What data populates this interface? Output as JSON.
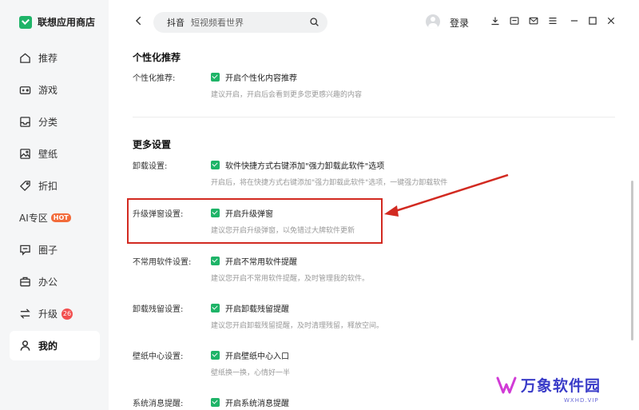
{
  "app": {
    "title": "联想应用商店"
  },
  "sidebar": {
    "items": [
      {
        "label": "推荐",
        "icon": "home-icon"
      },
      {
        "label": "游戏",
        "icon": "gamepad-icon"
      },
      {
        "label": "分类",
        "icon": "inbox-icon"
      },
      {
        "label": "壁纸",
        "icon": "image-icon"
      },
      {
        "label": "折扣",
        "icon": "tag-icon"
      },
      {
        "label": "AI专区",
        "icon": "ai-icon",
        "badge": "HOT"
      },
      {
        "label": "圈子",
        "icon": "chat-icon"
      },
      {
        "label": "办公",
        "icon": "briefcase-icon"
      },
      {
        "label": "升级",
        "icon": "swap-icon",
        "badge": "26"
      },
      {
        "label": "我的",
        "icon": "user-icon",
        "active": true
      }
    ]
  },
  "topbar": {
    "search_keyword": "抖音",
    "search_placeholder": "短视频看世界",
    "login_label": "登录"
  },
  "settings": {
    "personal": {
      "title": "个性化推荐",
      "label": "个性化推荐:",
      "option": "开启个性化内容推荐",
      "hint": "建议开启，开启后会看到更多您更感兴趣的内容"
    },
    "more_title": "更多设置",
    "uninstall": {
      "label": "卸载设置:",
      "option": "软件快捷方式右键添加\"强力卸载此软件\"选项",
      "hint": "开启后，将在快捷方式右键添加\"强力卸载此软件\"选项，一键强力卸载软件"
    },
    "upgrade_popup": {
      "label": "升级弹窗设置:",
      "option": "开启升级弹窗",
      "hint": "建议您开启升级弹窗，以免错过大牌软件更新"
    },
    "unused": {
      "label": "不常用软件设置:",
      "option": "开启不常用软件提醒",
      "hint": "建议您开启不常用软件提醒，及时管理我的软件。"
    },
    "residue": {
      "label": "卸载残留设置:",
      "option": "开启卸载残留提醒",
      "hint": "建议您开启卸载残留提醒，及时清理残留，释放空间。"
    },
    "wallpaper": {
      "label": "壁纸中心设置:",
      "option": "开启壁纸中心入口",
      "hint": "壁纸换一换，心情好一半"
    },
    "system_msg": {
      "label": "系统消息提醒:",
      "option": "开启系统消息提醒"
    }
  },
  "watermark": {
    "text": "万象软件园",
    "sub": "WXHD.VIP"
  },
  "colors": {
    "accent": "#1fb468",
    "highlight": "#d22a21",
    "hot": "#f26b3a",
    "badge": "#f24f4f"
  }
}
